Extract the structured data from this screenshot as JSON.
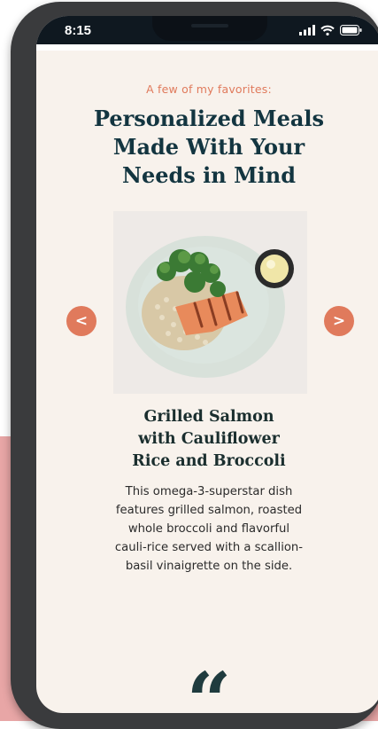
{
  "status": {
    "time": "8:15"
  },
  "content": {
    "eyebrow": "A few of my favorites:",
    "headline_lines": [
      "Personalized Meals",
      "Made With Your",
      "Needs in Mind"
    ],
    "dish": {
      "title_lines": [
        "Grilled Salmon",
        "with Cauliflower",
        "Rice and Broccoli"
      ],
      "description_lines": [
        "This omega-3-superstar dish",
        "features grilled salmon, roasted",
        "whole broccoli and flavorful",
        "cauli-rice served with a scallion-",
        "basil vinaigrette on the side."
      ]
    },
    "carousel": {
      "prev_label": "<",
      "next_label": ">"
    },
    "quote_mark": "“"
  },
  "colors": {
    "accent": "#e07a5c",
    "heading": "#133540",
    "background": "#f8f2ec",
    "pink_band": "#e8a6a6",
    "phone_frame": "#3a3b3d"
  },
  "icons": [
    "cellular-signal-icon",
    "wifi-icon",
    "battery-icon",
    "chevron-left-icon",
    "chevron-right-icon",
    "quote-icon"
  ]
}
